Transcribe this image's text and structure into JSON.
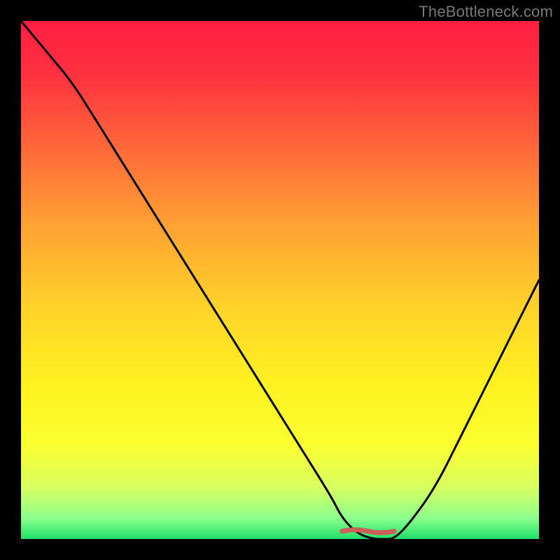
{
  "watermark": "TheBottleneck.com",
  "chart_data": {
    "type": "line",
    "title": "",
    "xlabel": "",
    "ylabel": "",
    "xlim": [
      0,
      100
    ],
    "ylim": [
      0,
      100
    ],
    "grid": false,
    "legend": false,
    "background": {
      "type": "vertical-gradient",
      "stops": [
        {
          "pos": 0.0,
          "color": "#ff1f41"
        },
        {
          "pos": 0.1,
          "color": "#ff3040"
        },
        {
          "pos": 0.25,
          "color": "#ff6a3a"
        },
        {
          "pos": 0.4,
          "color": "#ffa332"
        },
        {
          "pos": 0.55,
          "color": "#ffd22a"
        },
        {
          "pos": 0.7,
          "color": "#fff120"
        },
        {
          "pos": 0.82,
          "color": "#faff30"
        },
        {
          "pos": 0.9,
          "color": "#d8ff60"
        },
        {
          "pos": 0.96,
          "color": "#8cff8c"
        },
        {
          "pos": 1.0,
          "color": "#1fe06a"
        }
      ]
    },
    "series": [
      {
        "name": "bottleneck-curve",
        "color": "#000000",
        "x": [
          0,
          5,
          10,
          15,
          20,
          25,
          30,
          35,
          40,
          45,
          50,
          55,
          60,
          62,
          65,
          68,
          70,
          72,
          75,
          80,
          85,
          90,
          95,
          100
        ],
        "y": [
          100,
          94,
          88,
          80,
          72,
          64,
          56,
          48,
          40,
          32,
          24,
          16,
          8,
          4,
          1,
          0,
          0,
          0,
          3,
          10,
          20,
          30,
          40,
          50
        ]
      },
      {
        "name": "highlight-dash",
        "color": "#cc5f58",
        "x": [
          62,
          72
        ],
        "y": [
          1.5,
          1.5
        ]
      }
    ],
    "optimal_range_x": [
      62,
      72
    ]
  }
}
